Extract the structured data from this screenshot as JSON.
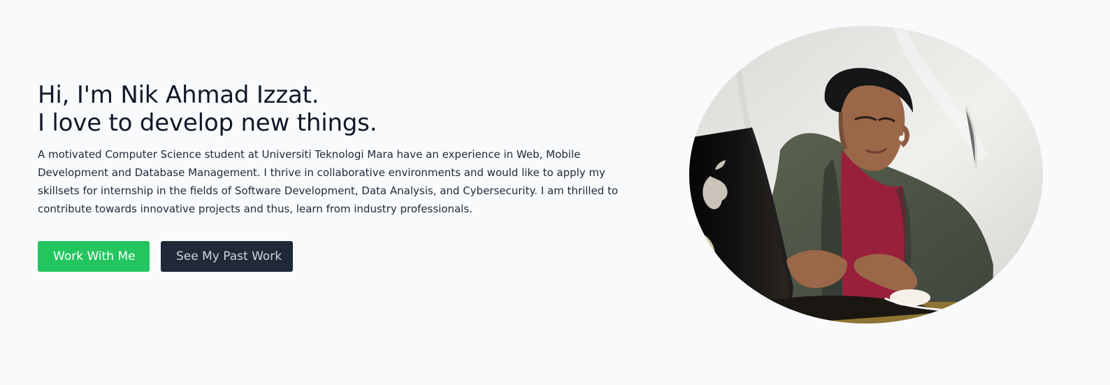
{
  "hero": {
    "title_line1": "Hi, I'm Nik Ahmad Izzat.",
    "title_line2": "I love to develop new things.",
    "intro": "A motivated Computer Science student at Universiti Teknologi Mara have an experience in Web, Mobile Development and Database Management. I thrive in collaborative environments and would like to apply my skillsets for internship in the fields of Software Development, Data Analysis, and Cybersecurity. I am thrilled to contribute towards innovative projects and thus, learn from industry professionals.",
    "primary_button": "Work With Me",
    "secondary_button": "See My Past Work"
  },
  "colors": {
    "background": "#f8fafc",
    "primary_button": "#22c55e",
    "secondary_button": "#1f2937"
  },
  "portrait": {
    "icon": "profile-photo"
  }
}
